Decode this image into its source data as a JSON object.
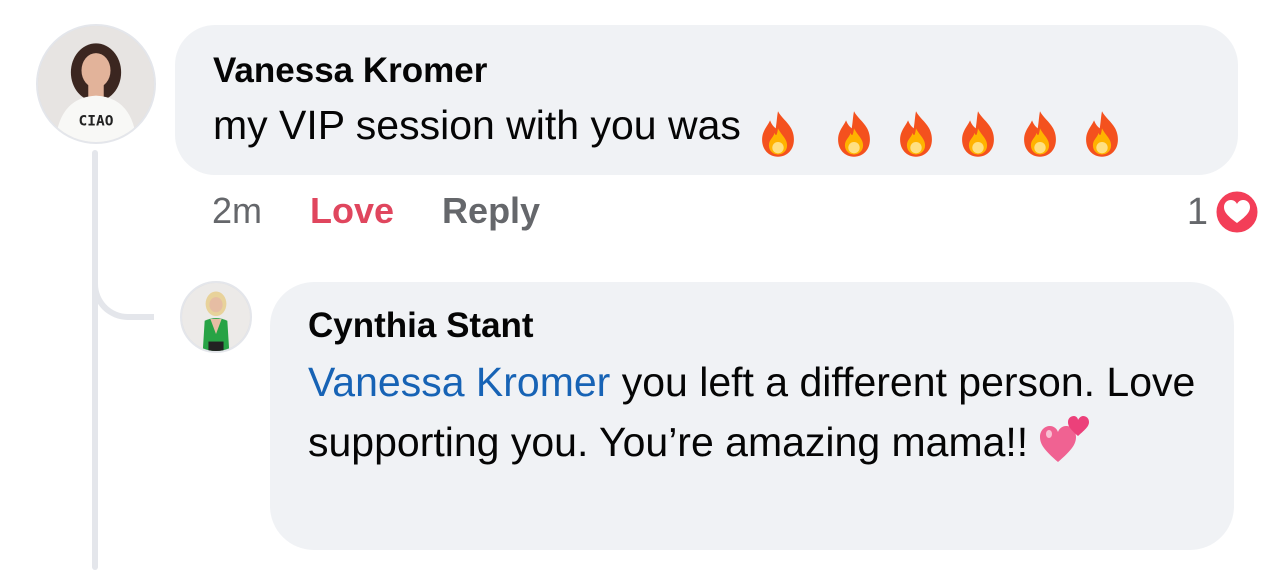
{
  "comment": {
    "author": "Vanessa Kromer",
    "text": "my VIP session with you was",
    "emoji": [
      "fire-icon",
      "fire-icon",
      "fire-icon",
      "fire-icon",
      "fire-icon",
      "fire-icon"
    ],
    "avatar_shirt_text": "CIAO",
    "timestamp": "2m",
    "love_label": "Love",
    "reply_label": "Reply",
    "reaction_count": "1",
    "reaction_type": "love-reaction-icon"
  },
  "reply": {
    "author": "Cynthia Stant",
    "mention": "Vanessa Kromer",
    "text": " you left a different person. Love supporting you. You’re amazing mama!!",
    "emoji": "two-hearts-icon"
  },
  "colors": {
    "bubble": "#f0f2f5",
    "mention": "#1763b5",
    "love": "#e0465e",
    "meta": "#65676b",
    "thread_line": "#e4e6eb"
  }
}
